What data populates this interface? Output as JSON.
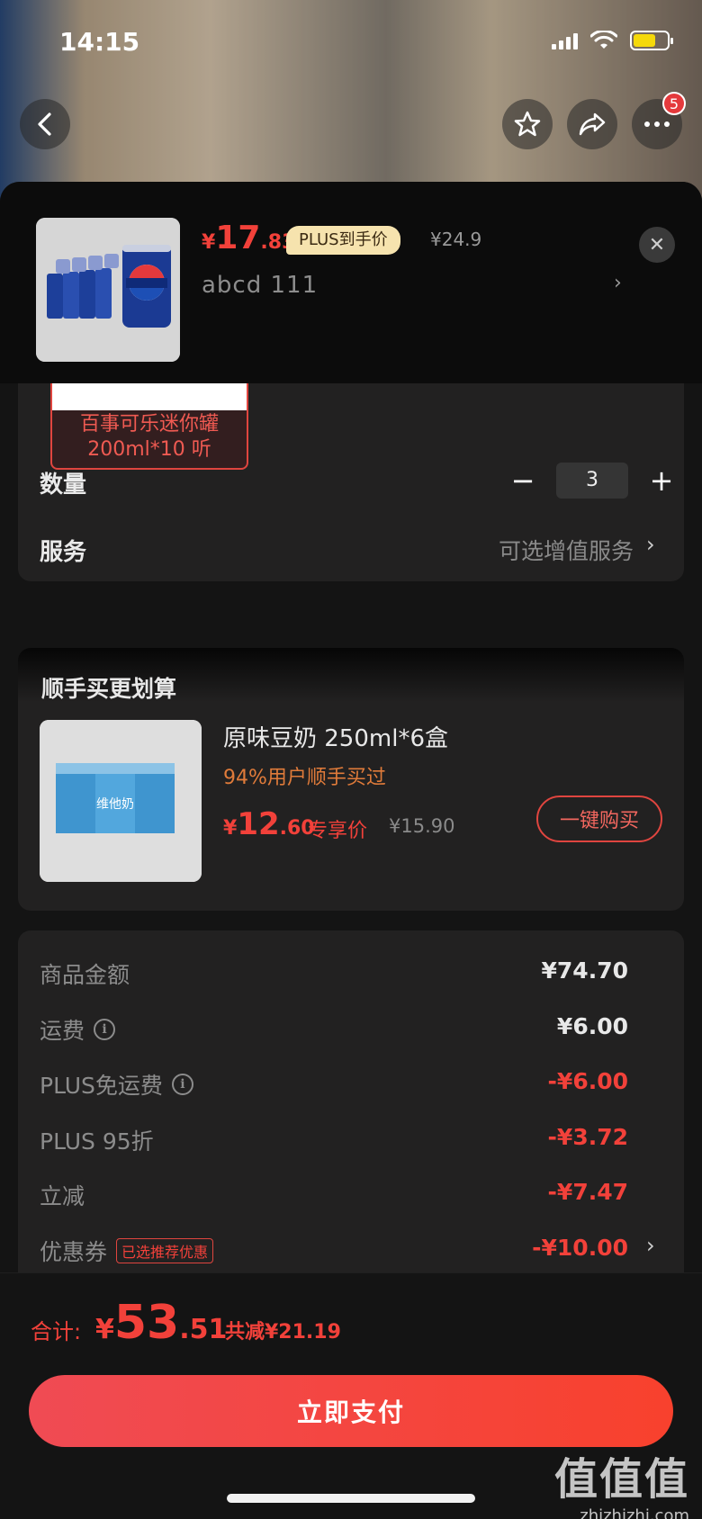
{
  "status": {
    "time": "14:15"
  },
  "nav": {
    "cart_badge": "5"
  },
  "product": {
    "price_currency": "¥",
    "price_int": "17",
    "price_dec": ".83",
    "plus_tag": "PLUS到手价",
    "original_price": "¥24.9",
    "spec_text": "abcd  111",
    "thumb_brand_text": "百事可乐"
  },
  "sku_option": {
    "label": "百事可乐迷你罐\n200ml*10 听"
  },
  "quantity": {
    "label": "数量",
    "value": "3",
    "minus": "−",
    "plus": "+"
  },
  "service": {
    "label": "服务",
    "value": "可选增值服务"
  },
  "upsell": {
    "title": "顺手买更划算",
    "name": "原味豆奶 250ml*6盒",
    "rate": "94%用户顺手买过",
    "price_currency": "¥",
    "price_int": "12",
    "price_dec": ".60",
    "price_tag": "专享价",
    "original_price": "¥15.90",
    "buy_label": "一键购买",
    "thumb_brand_text": "维他奶"
  },
  "fees": [
    {
      "label": "商品金额",
      "value": "¥74.70"
    },
    {
      "label": "运费",
      "value": "¥6.00"
    },
    {
      "label": "PLUS免运费",
      "value": "-¥6.00"
    },
    {
      "label": "PLUS 95折",
      "value": "-¥3.72"
    },
    {
      "label": "立减",
      "value": "-¥7.47"
    },
    {
      "label": "优惠券",
      "tag": "已选推荐优惠",
      "value": "-¥10.00"
    }
  ],
  "total": {
    "label": "合计:",
    "currency": "¥",
    "int": "53",
    "dec": ".51",
    "savings": "共减¥21.19"
  },
  "pay_button": "立即支付",
  "watermark": {
    "big": "值值值",
    "small": "zhizhizhi.com"
  },
  "colors": {
    "accent": "#f2413a",
    "plus_tag_bg": "#f6e3ae",
    "card_bg": "#222121"
  },
  "icons": [
    "back-icon",
    "star-icon",
    "share-icon",
    "more-icon",
    "close-icon",
    "info-icon",
    "chevron-right-icon"
  ]
}
